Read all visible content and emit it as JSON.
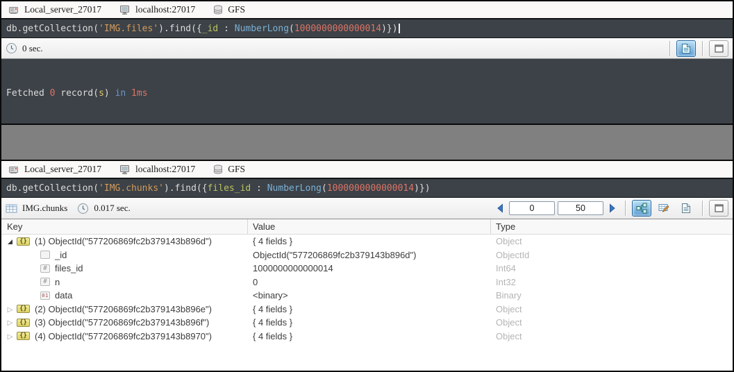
{
  "tabs": {
    "items": [
      {
        "label": "Local_server_27017",
        "icon": "server-icon"
      },
      {
        "label": "localhost:27017",
        "icon": "monitor-icon"
      },
      {
        "label": "GFS",
        "icon": "database-icon"
      }
    ]
  },
  "colors": {
    "editor_bg": "#3c4247",
    "string_orange": "#d49a5c",
    "property_yellow": "#bcc25e",
    "function_blue": "#7cb0d6",
    "number_red": "#dd7467",
    "selected_button_blue": "#5b9bd0",
    "divider_gray": "#808080",
    "type_column_gray": "#b4b4b4"
  },
  "top_panel": {
    "query_tokens": [
      {
        "t": "db.getCollection(",
        "c": "plain"
      },
      {
        "t": "'IMG.files'",
        "c": "str"
      },
      {
        "t": ").find({",
        "c": "plain"
      },
      {
        "t": "_id",
        "c": "prop"
      },
      {
        "t": " : ",
        "c": "plain"
      },
      {
        "t": "NumberLong",
        "c": "func"
      },
      {
        "t": "(",
        "c": "plain"
      },
      {
        "t": "1000000000000014",
        "c": "num"
      },
      {
        "t": ")})",
        "c": "plain"
      }
    ],
    "status": {
      "time": "0 sec."
    },
    "output_tokens": [
      {
        "t": "Fetched ",
        "c": "plain"
      },
      {
        "t": "0",
        "c": "num"
      },
      {
        "t": " record(",
        "c": "plain"
      },
      {
        "t": "s",
        "c": "yel"
      },
      {
        "t": ") ",
        "c": "plain"
      },
      {
        "t": "in",
        "c": "blu"
      },
      {
        "t": " ",
        "c": "plain"
      },
      {
        "t": "1ms",
        "c": "num"
      }
    ]
  },
  "bottom_panel": {
    "query_tokens": [
      {
        "t": "db.getCollection(",
        "c": "plain"
      },
      {
        "t": "'IMG.chunks'",
        "c": "str"
      },
      {
        "t": ").find({",
        "c": "plain"
      },
      {
        "t": "files_id",
        "c": "prop"
      },
      {
        "t": " : ",
        "c": "plain"
      },
      {
        "t": "NumberLong",
        "c": "func"
      },
      {
        "t": "(",
        "c": "plain"
      },
      {
        "t": "1000000000000014",
        "c": "num"
      },
      {
        "t": ")})",
        "c": "plain"
      }
    ],
    "status": {
      "collection": "IMG.chunks",
      "time": "0.017 sec."
    },
    "pagination": {
      "skip": "0",
      "limit": "50"
    },
    "table": {
      "columns": {
        "key": "Key",
        "value": "Value",
        "type": "Type"
      },
      "rows": [
        {
          "indent": 0,
          "expanded": true,
          "icon": "object",
          "key": "(1) ObjectId(\"577206869fc2b379143b896d\")",
          "value": "{ 4 fields }",
          "type": "Object"
        },
        {
          "indent": 1,
          "expanded": false,
          "icon": "plain",
          "key": "_id",
          "value": "ObjectId(\"577206869fc2b379143b896d\")",
          "type": "ObjectId"
        },
        {
          "indent": 1,
          "expanded": false,
          "icon": "hash",
          "key": "files_id",
          "value": "1000000000000014",
          "type": "Int64"
        },
        {
          "indent": 1,
          "expanded": false,
          "icon": "hash",
          "key": "n",
          "value": "0",
          "type": "Int32"
        },
        {
          "indent": 1,
          "expanded": false,
          "icon": "binary",
          "key": "data",
          "value": "<binary>",
          "type": "Binary"
        },
        {
          "indent": 0,
          "expanded": false,
          "icon": "object",
          "key": "(2) ObjectId(\"577206869fc2b379143b896e\")",
          "value": "{ 4 fields }",
          "type": "Object"
        },
        {
          "indent": 0,
          "expanded": false,
          "icon": "object",
          "key": "(3) ObjectId(\"577206869fc2b379143b896f\")",
          "value": "{ 4 fields }",
          "type": "Object"
        },
        {
          "indent": 0,
          "expanded": false,
          "icon": "object",
          "key": "(4) ObjectId(\"577206869fc2b379143b8970\")",
          "value": "{ 4 fields }",
          "type": "Object"
        }
      ]
    }
  }
}
